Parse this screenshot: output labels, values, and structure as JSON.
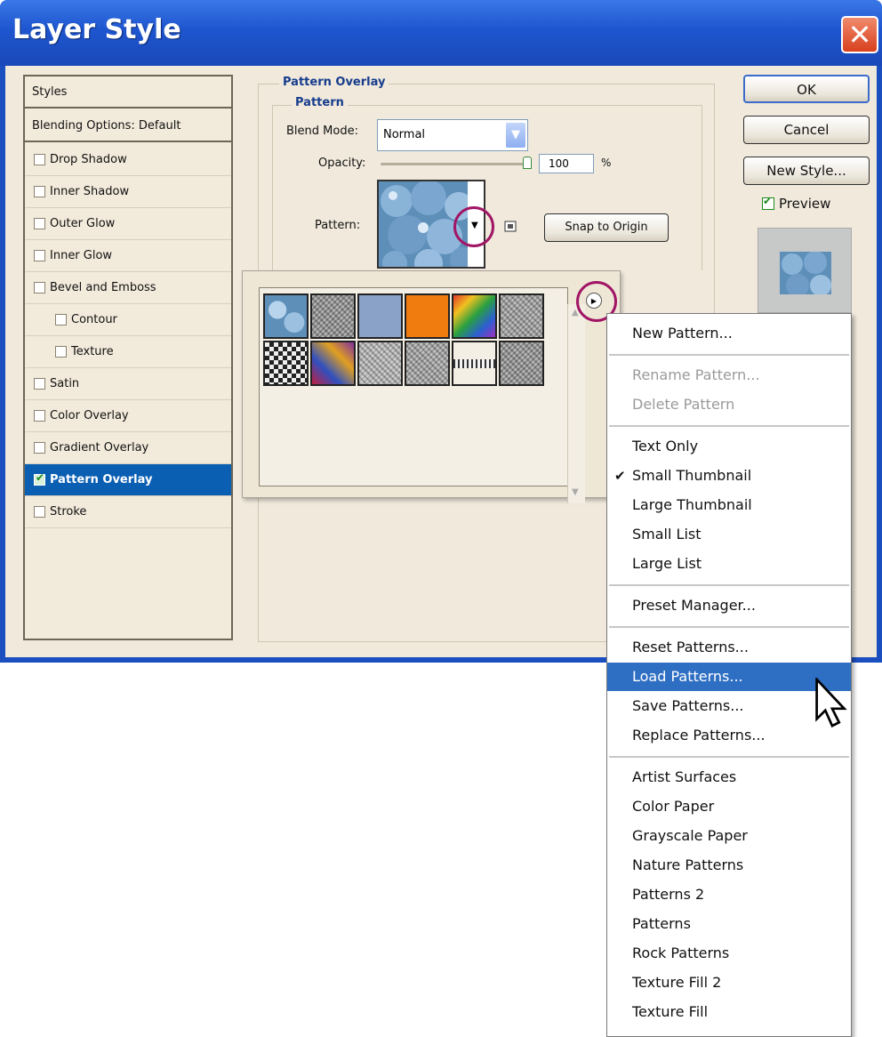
{
  "window": {
    "title": "Layer Style",
    "close_label": "✕"
  },
  "styles_panel": {
    "header": "Styles",
    "blending": "Blending Options: Default",
    "items": [
      {
        "label": "Drop Shadow",
        "checked": false,
        "indent": false
      },
      {
        "label": "Inner Shadow",
        "checked": false,
        "indent": false
      },
      {
        "label": "Outer Glow",
        "checked": false,
        "indent": false
      },
      {
        "label": "Inner Glow",
        "checked": false,
        "indent": false
      },
      {
        "label": "Bevel and Emboss",
        "checked": false,
        "indent": false
      },
      {
        "label": "Contour",
        "checked": false,
        "indent": true
      },
      {
        "label": "Texture",
        "checked": false,
        "indent": true
      },
      {
        "label": "Satin",
        "checked": false,
        "indent": false
      },
      {
        "label": "Color Overlay",
        "checked": false,
        "indent": false
      },
      {
        "label": "Gradient Overlay",
        "checked": false,
        "indent": false
      },
      {
        "label": "Pattern Overlay",
        "checked": true,
        "indent": false,
        "selected": true
      },
      {
        "label": "Stroke",
        "checked": false,
        "indent": false
      }
    ]
  },
  "pattern_overlay": {
    "group_title": "Pattern Overlay",
    "subgroup_title": "Pattern",
    "blend_mode_label": "Blend Mode:",
    "blend_mode_value": "Normal",
    "opacity_label": "Opacity:",
    "opacity_value": "100",
    "opacity_unit": "%",
    "opacity_level": 1.0,
    "pattern_label": "Pattern:",
    "snap_button": "Snap to Origin"
  },
  "buttons": {
    "ok": "OK",
    "cancel": "Cancel",
    "new_style": "New Style...",
    "preview": "Preview",
    "preview_checked": true
  },
  "pattern_picker": {
    "tiles": [
      {
        "name": "bubbles-pattern",
        "color": "#5d8fb8"
      },
      {
        "name": "gray-noise-pattern",
        "color": "#8a8a8a"
      },
      {
        "name": "blue-solid-pattern",
        "color": "#8aa2c8"
      },
      {
        "name": "orange-solid-pattern",
        "color": "#f07c10"
      },
      {
        "name": "rainbow-pattern",
        "color": "#3a8a2a"
      },
      {
        "name": "marble-pattern",
        "color": "#9a9a9a"
      },
      {
        "name": "checker-pattern",
        "color": "#444444"
      },
      {
        "name": "multicolor-pattern",
        "color": "#a03050"
      },
      {
        "name": "gray-mottled-pattern",
        "color": "#b0b0b0"
      },
      {
        "name": "gray-texture-pattern",
        "color": "#9c9c9c"
      },
      {
        "name": "stripe-pattern",
        "color": "#f4f4f4"
      },
      {
        "name": "stone-pattern",
        "color": "#8c8c8c"
      }
    ]
  },
  "menu": {
    "items": [
      {
        "label": "New Pattern...",
        "state": "normal"
      },
      {
        "label": "Rename Pattern...",
        "state": "disabled"
      },
      {
        "label": "Delete Pattern",
        "state": "disabled"
      },
      {
        "label": "Text Only",
        "state": "normal"
      },
      {
        "label": "Small Thumbnail",
        "state": "checked"
      },
      {
        "label": "Large Thumbnail",
        "state": "normal"
      },
      {
        "label": "Small List",
        "state": "normal"
      },
      {
        "label": "Large List",
        "state": "normal"
      },
      {
        "label": "Preset Manager...",
        "state": "normal"
      },
      {
        "label": "Reset Patterns...",
        "state": "normal"
      },
      {
        "label": "Load Patterns...",
        "state": "highlighted"
      },
      {
        "label": "Save Patterns...",
        "state": "normal"
      },
      {
        "label": "Replace Patterns...",
        "state": "normal"
      },
      {
        "label": "Artist Surfaces",
        "state": "normal"
      },
      {
        "label": "Color Paper",
        "state": "normal"
      },
      {
        "label": "Grayscale Paper",
        "state": "normal"
      },
      {
        "label": "Nature Patterns",
        "state": "normal"
      },
      {
        "label": "Patterns 2",
        "state": "normal"
      },
      {
        "label": "Patterns",
        "state": "normal"
      },
      {
        "label": "Rock Patterns",
        "state": "normal"
      },
      {
        "label": "Texture Fill 2",
        "state": "normal"
      },
      {
        "label": "Texture Fill",
        "state": "normal"
      }
    ],
    "check_mark": "✔"
  },
  "colors": {
    "accent": "#0a5fb3",
    "highlight": "#2f6fc3",
    "title_bar": "#1e55cf",
    "annotation_circle": "#a11565"
  }
}
